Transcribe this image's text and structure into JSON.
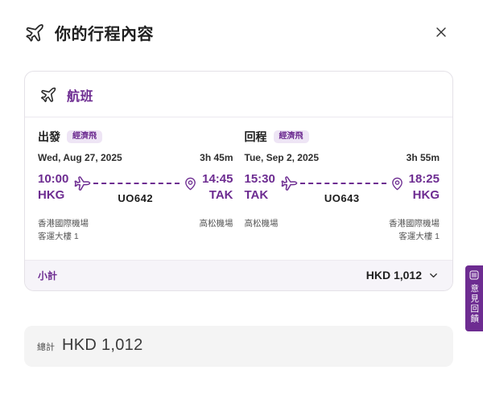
{
  "header": {
    "title": "你的行程內容"
  },
  "card": {
    "section_title": "航班",
    "legs": [
      {
        "direction_label": "出發",
        "fare_badge": "經濟飛",
        "date": "Wed, Aug 27, 2025",
        "duration": "3h 45m",
        "dep_time": "10:00",
        "dep_code": "HKG",
        "arr_time": "14:45",
        "arr_code": "TAK",
        "flight_no": "UO642",
        "dep_airport": "香港國際機場",
        "dep_terminal": "客運大樓 1",
        "arr_airport": "高松機場",
        "arr_terminal": ""
      },
      {
        "direction_label": "回程",
        "fare_badge": "經濟飛",
        "date": "Tue, Sep 2, 2025",
        "duration": "3h 55m",
        "dep_time": "15:30",
        "dep_code": "TAK",
        "arr_time": "18:25",
        "arr_code": "HKG",
        "flight_no": "UO643",
        "dep_airport": "高松機場",
        "dep_terminal": "",
        "arr_airport": "香港國際機場",
        "arr_terminal": "客運大樓 1"
      }
    ],
    "subtotal": {
      "label": "小計",
      "amount": "HKD 1,012"
    }
  },
  "total": {
    "label": "總計",
    "amount": "HKD 1,012"
  },
  "feedback_tab": {
    "label": "意見回饋"
  },
  "colors": {
    "brand_purple": "#6D2C91",
    "badge_bg": "#EEE5F5",
    "subtotal_bg": "#F6F4F9",
    "total_bg": "#F4F4F4",
    "card_border": "#E4E1E7"
  }
}
